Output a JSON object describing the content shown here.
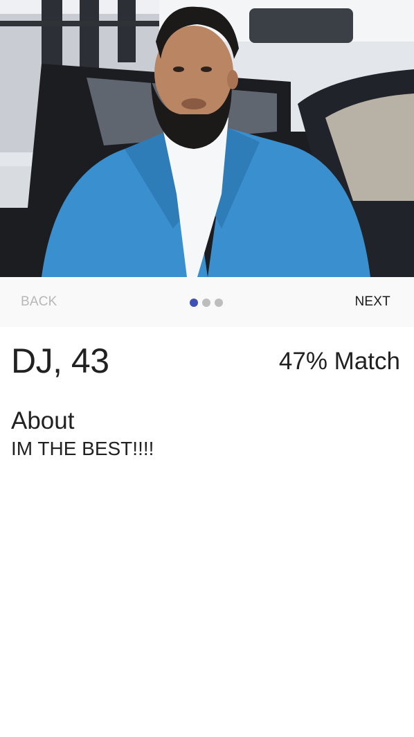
{
  "profile": {
    "photo_alt": "Profile photo",
    "name_age": "DJ, 43",
    "match": "47% Match",
    "about_heading": "About",
    "about_text": "IM THE BEST!!!!"
  },
  "stepper": {
    "back_label": "BACK",
    "next_label": "NEXT",
    "total_steps": 3,
    "active_step": 1
  },
  "colors": {
    "accent": "#3f51b5",
    "dot_inactive": "#bdbdbd",
    "disabled_text": "#b7b7b7",
    "stepper_bg": "#f9f9f9",
    "jacket": "#3a8fcf"
  }
}
